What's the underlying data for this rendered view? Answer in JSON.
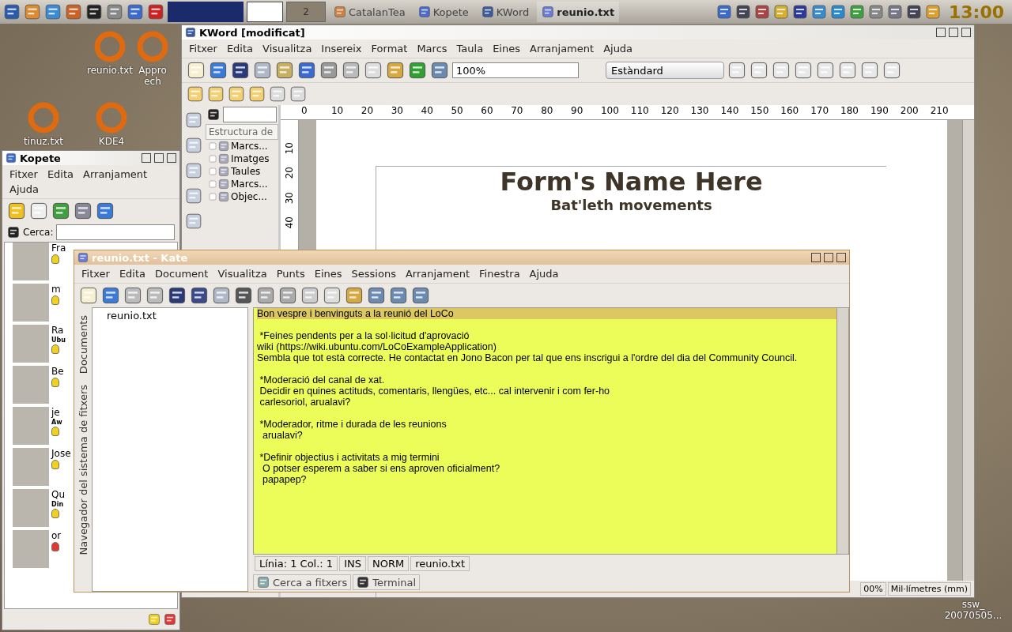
{
  "taskbar": {
    "pager": "2",
    "tasks": [
      {
        "label": "CatalanTea",
        "selected": false
      },
      {
        "label": "Kopete",
        "selected": false
      },
      {
        "label": "KWord",
        "selected": false
      },
      {
        "label": "reunio.txt",
        "selected": true
      }
    ],
    "clock": "13:00"
  },
  "desktop_icons": [
    {
      "lines": [
        "reunio.txt"
      ]
    },
    {
      "lines": [
        "Appro",
        "ech"
      ]
    },
    {
      "lines": [
        "tinuz.txt"
      ]
    },
    {
      "lines": [
        "KDE4"
      ]
    },
    {
      "lines": [
        "ssw_",
        "20070505..."
      ]
    }
  ],
  "kword": {
    "title": "KWord [modificat]",
    "menu": [
      "Fitxer",
      "Edita",
      "Visualitza",
      "Insereix",
      "Format",
      "Marcs",
      "Taula",
      "Eines",
      "Arranjament",
      "Ajuda"
    ],
    "zoom": "100%",
    "style": "Estàndard",
    "structure_title": "Estructura de",
    "structure": [
      "Marcs...",
      "Imatges",
      "Taules",
      "Marcs...",
      "Objec..."
    ],
    "ruler": [
      "0",
      "10",
      "20",
      "30",
      "40",
      "50",
      "60",
      "70",
      "80",
      "90",
      "100",
      "110",
      "120",
      "130",
      "140",
      "150",
      "160",
      "170",
      "180",
      "190",
      "200",
      "210"
    ],
    "vruler": [
      "10",
      "20",
      "30",
      "40"
    ],
    "heading": "Form's Name Here",
    "subheading": "Bat'leth movements",
    "status": [
      "00%",
      "Mil·límetres (mm)"
    ]
  },
  "kopete": {
    "title": "Kopete",
    "menu": [
      "Fitxer",
      "Edita",
      "Arranjament",
      "Ajuda"
    ],
    "search_label": "Cerca:",
    "contacts": [
      {
        "name": "Fra",
        "color": "#f0d020"
      },
      {
        "name": "m",
        "color": "#f0d020"
      },
      {
        "name": "Ra",
        "note": "Ubu",
        "color": "#f0d020"
      },
      {
        "name": "Be",
        "color": "#f0d020"
      },
      {
        "name": "je",
        "note": "Aw",
        "color": "#f0d020"
      },
      {
        "name": "Jose",
        "color": "#f0d020"
      },
      {
        "name": "Qu",
        "note": "Din",
        "color": "#f0d020"
      },
      {
        "name": "or",
        "color": "#e03838"
      }
    ]
  },
  "kate": {
    "title": "reunio.txt - Kate",
    "menu": [
      "Fitxer",
      "Edita",
      "Document",
      "Visualitza",
      "Punts",
      "Eines",
      "Sessions",
      "Arranjament",
      "Finestra",
      "Ajuda"
    ],
    "side_tabs": [
      "Documents",
      "Navegador del sistema de fitxers"
    ],
    "documents": [
      "reunio.txt"
    ],
    "current_line": "Bon vespre i benvinguts a la reunió del LoCo",
    "paragraphs": [
      [
        " *Feines pendents per a la sol·licitud d'aprovació",
        "wiki (https://wiki.ubuntu.com/LoCoExampleApplication)",
        "Sembla que tot està correcte. He contactat en Jono Bacon per tal que ens inscrigui a l'ordre del dia del Community Council."
      ],
      [
        " *Moderació del canal de xat.",
        " Decidir en quines actituds, comentaris, llengües, etc... cal intervenir i com fer-ho",
        " carlesoriol, arualavi?"
      ],
      [
        " *Moderador, ritme i durada de les reunions",
        "  arualavi?"
      ],
      [
        " *Definir objectius i activitats a mig termini",
        "  O potser esperem a saber si ens aproven oficialment?",
        "  papapep?"
      ]
    ],
    "status": [
      "Línia: 1 Col.: 1",
      "INS",
      "NORM",
      "reunio.txt"
    ],
    "bottom_tabs": [
      "Cerca a fitxers",
      "Terminal"
    ]
  }
}
